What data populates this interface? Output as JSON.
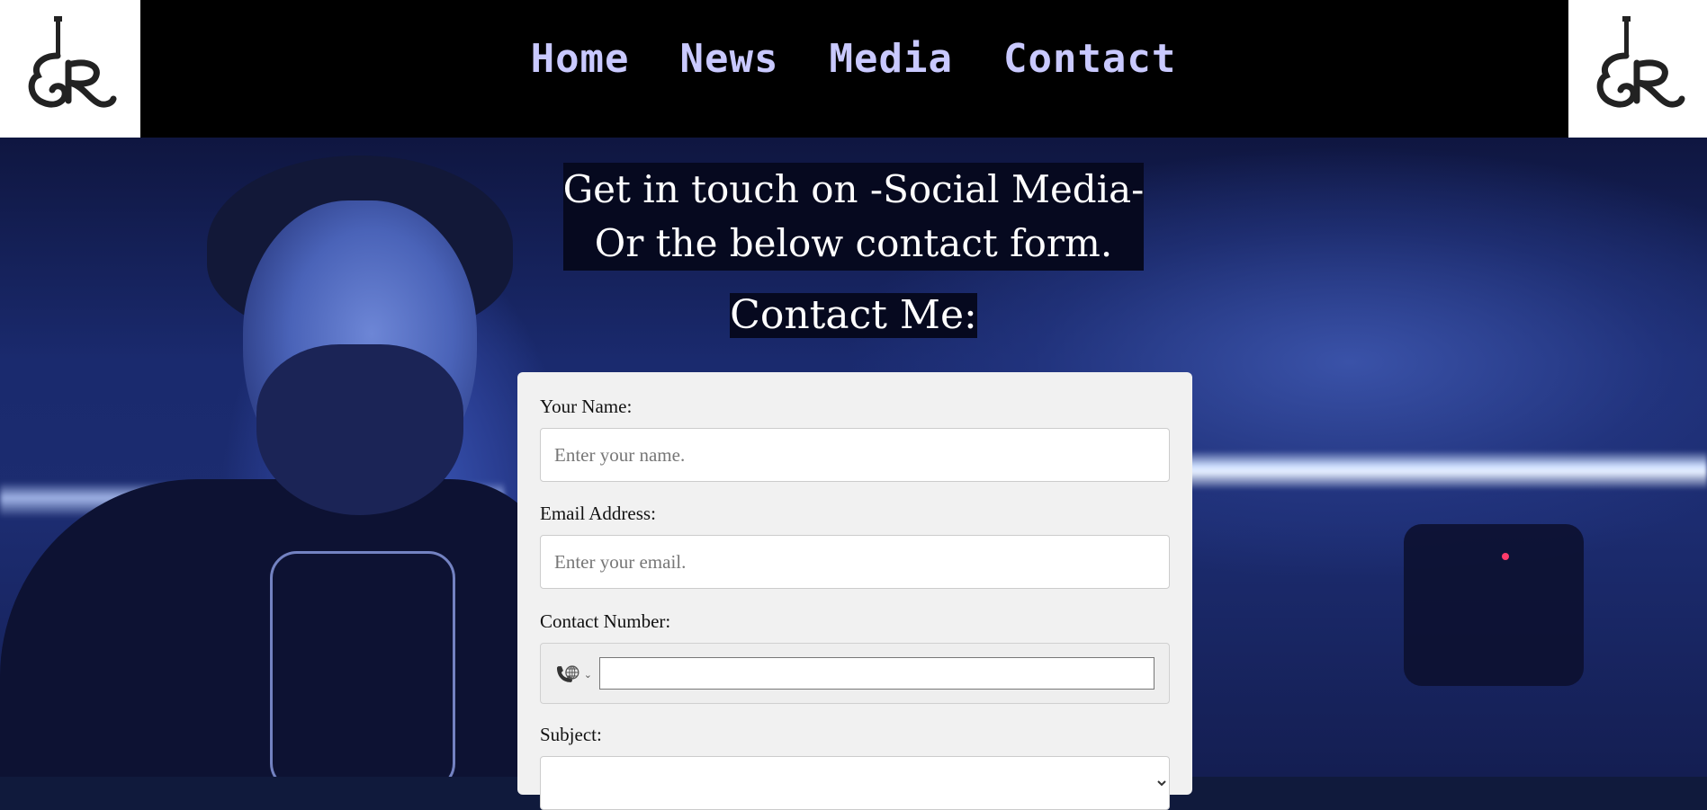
{
  "nav": {
    "items": [
      {
        "label": "Home"
      },
      {
        "label": "News"
      },
      {
        "label": "Media"
      },
      {
        "label": "Contact"
      }
    ],
    "link_color": "#c9c9ff"
  },
  "logo": {
    "name": "guitar-sr-logo"
  },
  "intro": {
    "line1": "Get in touch on -Social Media-",
    "line2": "Or the below contact form."
  },
  "contact_title": "Contact Me:",
  "form": {
    "name_label": "Your Name:",
    "name_placeholder": "Enter your name.",
    "email_label": "Email Address:",
    "email_placeholder": "Enter your email.",
    "phone_label": "Contact Number:",
    "phone_country_icon": "phone-globe-icon",
    "subject_label": "Subject:"
  }
}
